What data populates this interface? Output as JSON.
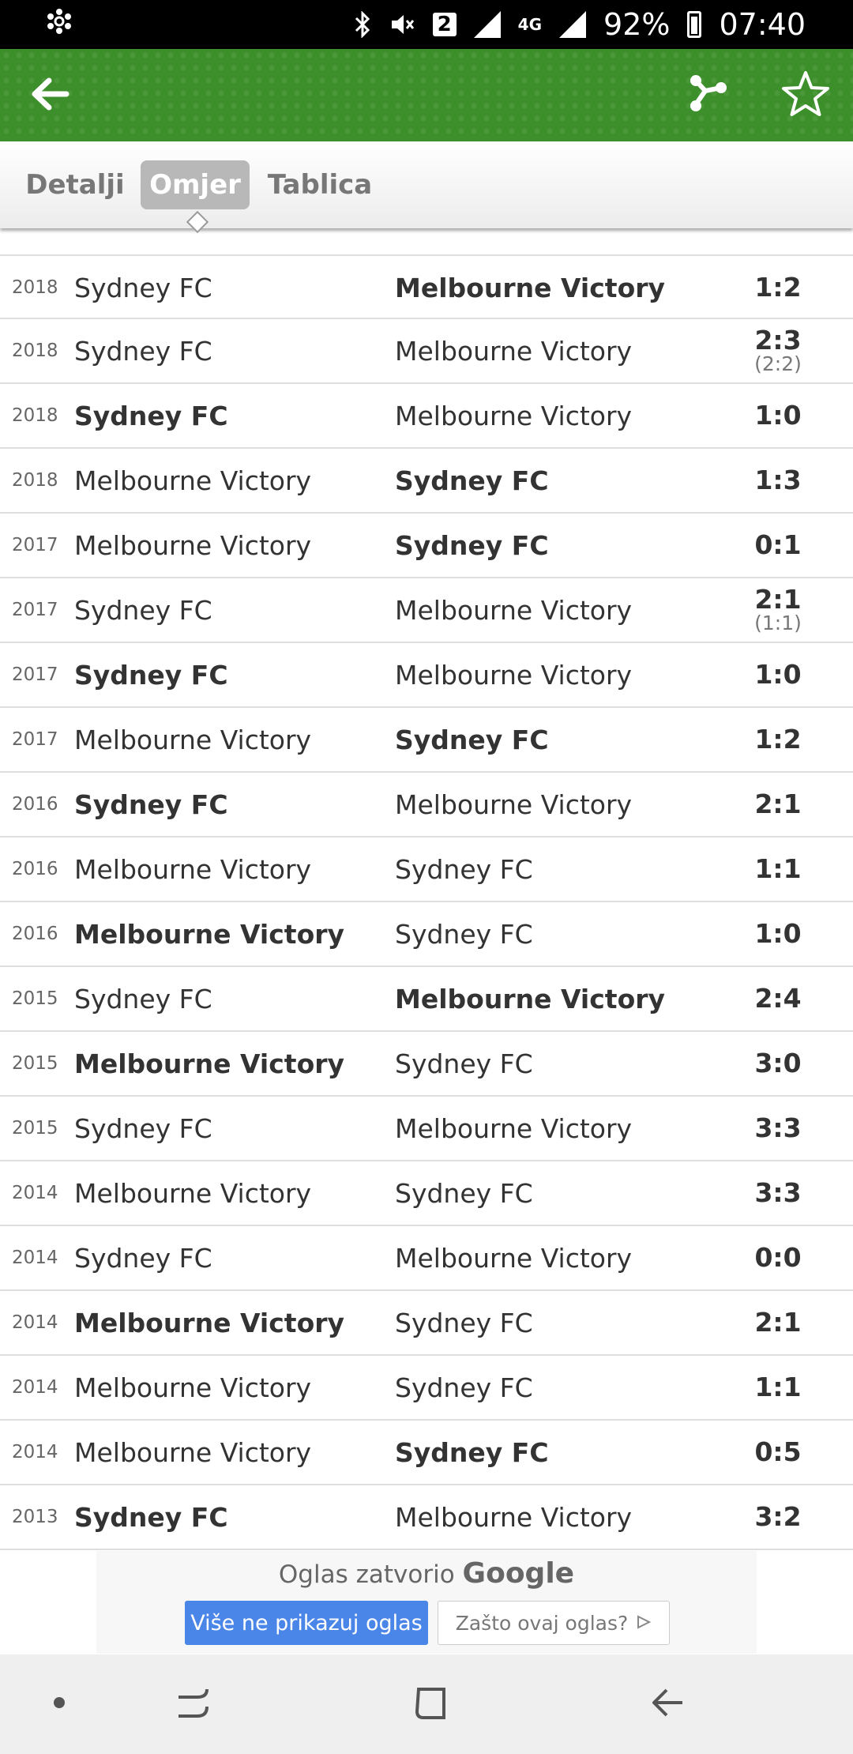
{
  "status_bar": {
    "network_badge": "2",
    "lte_label": "4G",
    "battery_percent": "92%",
    "time": "07:40"
  },
  "app_bar": {
    "icons": [
      "back-arrow-icon",
      "share-icon",
      "star-icon"
    ],
    "accent_color": "#3c8f2a"
  },
  "tabs": [
    {
      "label": "Detalji",
      "active": false
    },
    {
      "label": "Omjer",
      "active": true
    },
    {
      "label": "Tablica",
      "active": false
    }
  ],
  "matches": [
    {
      "year": "2018",
      "home": "Sydney FC",
      "away": "Melbourne Victory",
      "score": "1:2",
      "winner": "away"
    },
    {
      "year": "2018",
      "home": "Sydney FC",
      "away": "Melbourne Victory",
      "score": "2:3",
      "sub": "(2:2)",
      "winner": "none"
    },
    {
      "year": "2018",
      "home": "Sydney FC",
      "away": "Melbourne Victory",
      "score": "1:0",
      "winner": "home"
    },
    {
      "year": "2018",
      "home": "Melbourne Victory",
      "away": "Sydney FC",
      "score": "1:3",
      "winner": "away"
    },
    {
      "year": "2017",
      "home": "Melbourne Victory",
      "away": "Sydney FC",
      "score": "0:1",
      "winner": "away"
    },
    {
      "year": "2017",
      "home": "Sydney FC",
      "away": "Melbourne Victory",
      "score": "2:1",
      "sub": "(1:1)",
      "winner": "none"
    },
    {
      "year": "2017",
      "home": "Sydney FC",
      "away": "Melbourne Victory",
      "score": "1:0",
      "winner": "home"
    },
    {
      "year": "2017",
      "home": "Melbourne Victory",
      "away": "Sydney FC",
      "score": "1:2",
      "winner": "away"
    },
    {
      "year": "2016",
      "home": "Sydney FC",
      "away": "Melbourne Victory",
      "score": "2:1",
      "winner": "home"
    },
    {
      "year": "2016",
      "home": "Melbourne Victory",
      "away": "Sydney FC",
      "score": "1:1",
      "winner": "none"
    },
    {
      "year": "2016",
      "home": "Melbourne Victory",
      "away": "Sydney FC",
      "score": "1:0",
      "winner": "home"
    },
    {
      "year": "2015",
      "home": "Sydney FC",
      "away": "Melbourne Victory",
      "score": "2:4",
      "winner": "away"
    },
    {
      "year": "2015",
      "home": "Melbourne Victory",
      "away": "Sydney FC",
      "score": "3:0",
      "winner": "home"
    },
    {
      "year": "2015",
      "home": "Sydney FC",
      "away": "Melbourne Victory",
      "score": "3:3",
      "winner": "none"
    },
    {
      "year": "2014",
      "home": "Melbourne Victory",
      "away": "Sydney FC",
      "score": "3:3",
      "winner": "none"
    },
    {
      "year": "2014",
      "home": "Sydney FC",
      "away": "Melbourne Victory",
      "score": "0:0",
      "winner": "none"
    },
    {
      "year": "2014",
      "home": "Melbourne Victory",
      "away": "Sydney FC",
      "score": "2:1",
      "winner": "home"
    },
    {
      "year": "2014",
      "home": "Melbourne Victory",
      "away": "Sydney FC",
      "score": "1:1",
      "winner": "none"
    },
    {
      "year": "2014",
      "home": "Melbourne Victory",
      "away": "Sydney FC",
      "score": "0:5",
      "winner": "away"
    },
    {
      "year": "2013",
      "home": "Sydney FC",
      "away": "Melbourne Victory",
      "score": "3:2",
      "winner": "home"
    }
  ],
  "ad": {
    "title": "Oglas zatvorio",
    "brand": "Google",
    "button_stop": "Više ne prikazuj oglas",
    "button_why": "Zašto ovaj oglas?",
    "button_stop_color": "#4a86e8"
  },
  "nav_bar": {
    "icons": [
      "dot-icon",
      "recent-apps-icon",
      "home-icon",
      "back-icon"
    ]
  }
}
